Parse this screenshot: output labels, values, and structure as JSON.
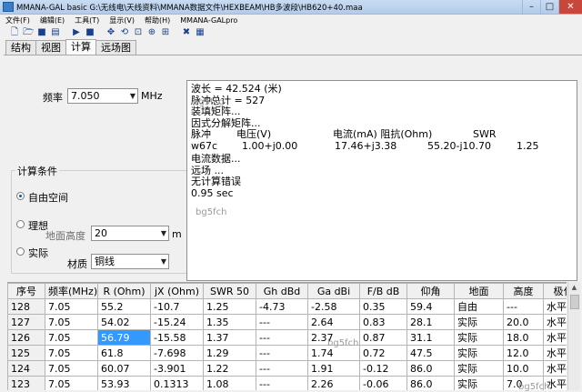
{
  "window": {
    "title": "MMANA-GAL basic  G:\\无线电\\天线资料\\MMANA数据文件\\HEXBEAM\\HB多波段\\HB620+40.maa",
    "minimize": "–",
    "maximize": "□",
    "close": "✕"
  },
  "menu": [
    "文件(F)",
    "编辑(E)",
    "工具(T)",
    "显示(V)",
    "帮助(H)",
    "MMANA-GALpro"
  ],
  "tabs": [
    "结构",
    "视图",
    "计算",
    "远场图"
  ],
  "form": {
    "freq_label": "频率",
    "freq_value": "7.050",
    "freq_unit": "MHz",
    "conditions_title": "计算条件",
    "radio_free": "自由空间",
    "radio_ideal": "理想",
    "radio_real": "实际",
    "ground_height_label": "地面高度",
    "ground_height_value": "20",
    "ground_height_unit": "m",
    "material_label": "材质",
    "material_value": "铜线"
  },
  "output": {
    "lines": [
      "波长 = 42.524 (米)",
      "脉冲总计 = 527",
      "装填矩阵...",
      "因式分解矩阵..."
    ],
    "headers": [
      "脉冲",
      "电压(V)",
      "电流(mA) 阻抗(Ohm)",
      "SWR"
    ],
    "row": [
      "w67c",
      "1.00+j0.00",
      "17.46+j3.38",
      "55.20-j10.70",
      "1.25"
    ],
    "lines2": [
      "电流数据...",
      "远场 ...",
      "无计算错误",
      "0.95 sec"
    ],
    "watermarks": [
      "bg5fcg",
      "bg5fch",
      "bg5fch",
      "bg5fch"
    ]
  },
  "table": {
    "headers": [
      "序号",
      "频率(MHz)",
      "R (Ohm)",
      "jX (Ohm)",
      "SWR 50",
      "Gh dBd",
      "Ga dBi",
      "F/B dB",
      "仰角",
      "地面",
      "高度",
      "极化"
    ],
    "rows": [
      [
        "128",
        "7.05",
        "55.2",
        "-10.7",
        "1.25",
        "-4.73",
        "-2.58",
        "0.35",
        "59.4",
        "自由",
        "---",
        "水平"
      ],
      [
        "127",
        "7.05",
        "54.02",
        "-15.24",
        "1.35",
        "---",
        "2.64",
        "0.83",
        "28.1",
        "实际",
        "20.0",
        "水平"
      ],
      [
        "126",
        "7.05",
        "56.79",
        "-15.58",
        "1.37",
        "---",
        "2.37",
        "0.87",
        "31.1",
        "实际",
        "18.0",
        "水平"
      ],
      [
        "125",
        "7.05",
        "61.8",
        "-7.698",
        "1.29",
        "---",
        "1.74",
        "0.72",
        "47.5",
        "实际",
        "12.0",
        "水平"
      ],
      [
        "124",
        "7.05",
        "60.07",
        "-3.901",
        "1.22",
        "---",
        "1.91",
        "-0.12",
        "86.0",
        "实际",
        "10.0",
        "水平"
      ],
      [
        "123",
        "7.05",
        "53.93",
        "0.1313",
        "1.08",
        "---",
        "2.26",
        "-0.06",
        "86.0",
        "实际",
        "7.0",
        "水平"
      ]
    ]
  },
  "colors": {
    "selection": "#3399ff",
    "titlebar": "#c8dcf2"
  }
}
